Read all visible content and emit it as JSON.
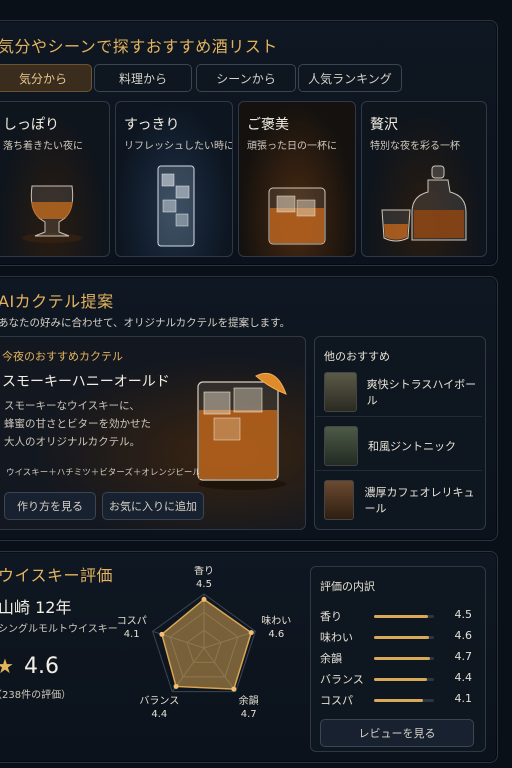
{
  "mood_section": {
    "title": "気分やシーンで探すおすすめ酒リスト",
    "tabs": [
      "気分から",
      "料理から",
      "シーンから",
      "人気ランキング"
    ],
    "active_tab": "気分から",
    "cards": [
      {
        "title": "しっぽり",
        "subtitle": "落ち着きたい夜に"
      },
      {
        "title": "すっきり",
        "subtitle": "リフレッシュしたい時に"
      },
      {
        "title": "ご褒美",
        "subtitle": "頑張った日の一杯に"
      },
      {
        "title": "贅沢",
        "subtitle": "特別な夜を彩る一杯"
      }
    ]
  },
  "cocktail_section": {
    "title": "AIカクテル提案",
    "description": "あなたの好みに合わせて、オリジナルカクテルを提案します。",
    "featured": {
      "label": "今夜のおすすめカクテル",
      "name": "スモーキーハニーオールド",
      "desc_line1": "スモーキーなウイスキーに、",
      "desc_line2": "蜂蜜の甘さとビターを効かせた",
      "desc_line3": "大人のオリジナルカクテル。",
      "ingredients": "ウイスキー＋ハチミツ＋ビターズ＋オレンジピール",
      "recipe_button": "作り方を見る",
      "favorite_button": "お気に入りに追加"
    },
    "others_title": "他のおすすめ",
    "others": [
      "爽快シトラスハイボール",
      "和風ジントニック",
      "濃厚カフェオレリキュール"
    ]
  },
  "rating_section": {
    "title": "ウイスキー評価",
    "name": "山崎 12年",
    "category": "シングルモルトウイスキー",
    "score": "4.6",
    "star": "★",
    "count": "（238件の評価）",
    "radar": [
      {
        "label": "香り",
        "value": 4.5
      },
      {
        "label": "味わい",
        "value": 4.6
      },
      {
        "label": "余韻",
        "value": 4.7
      },
      {
        "label": "バランス",
        "value": 4.4
      },
      {
        "label": "コスパ",
        "value": 4.1
      }
    ],
    "breakdown_title": "評価の内訳",
    "breakdown": [
      {
        "label": "香り",
        "value": "4.5",
        "ratio": 0.9
      },
      {
        "label": "味わい",
        "value": "4.6",
        "ratio": 0.92
      },
      {
        "label": "余韻",
        "value": "4.7",
        "ratio": 0.94
      },
      {
        "label": "バランス",
        "value": "4.4",
        "ratio": 0.88
      },
      {
        "label": "コスパ",
        "value": "4.1",
        "ratio": 0.82
      }
    ],
    "review_button": "レビューを見る"
  },
  "colors": {
    "accent": "#e3b35e",
    "panel": "#0f1722"
  }
}
